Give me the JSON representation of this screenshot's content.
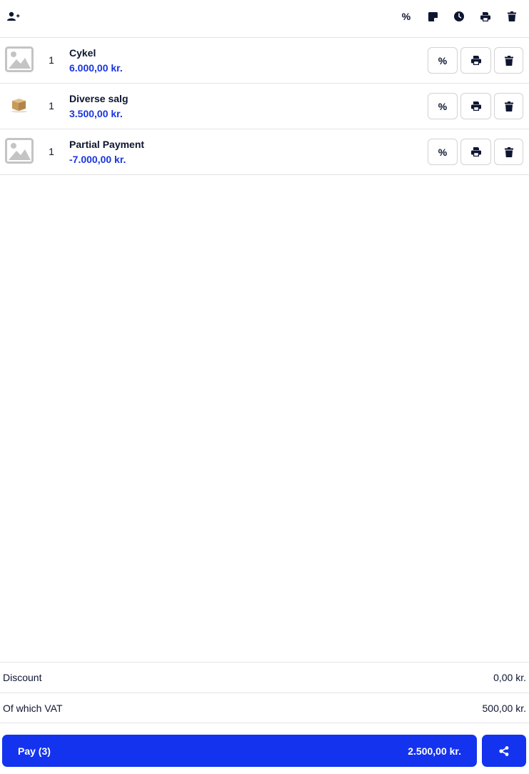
{
  "toolbar": {
    "left_icon": "add-customer-icon",
    "discount_label": "%",
    "icons": [
      "note-icon",
      "clock-icon",
      "printer-icon",
      "trash-icon"
    ]
  },
  "cart": {
    "items": [
      {
        "qty": "1",
        "name": "Cykel",
        "price": "6.000,00 kr.",
        "thumb": "image-placeholder-icon"
      },
      {
        "qty": "1",
        "name": "Diverse salg",
        "price": "3.500,00 kr.",
        "thumb": "box-icon"
      },
      {
        "qty": "1",
        "name": "Partial Payment",
        "price": "-7.000,00 kr.",
        "thumb": "image-placeholder-icon"
      }
    ],
    "row_actions": {
      "discount_label": "%",
      "print_icon": "printer-icon",
      "delete_icon": "trash-icon"
    }
  },
  "summary": {
    "discount_label": "Discount",
    "discount_value": "0,00 kr.",
    "vat_label": "Of which VAT",
    "vat_value": "500,00 kr."
  },
  "pay": {
    "label": "Pay (3)",
    "total": "2.500,00 kr.",
    "share_icon": "share-icon"
  },
  "colors": {
    "accent": "#1433ee",
    "price": "#1a34e0",
    "text": "#0d1530",
    "border": "#d2d2d2"
  }
}
